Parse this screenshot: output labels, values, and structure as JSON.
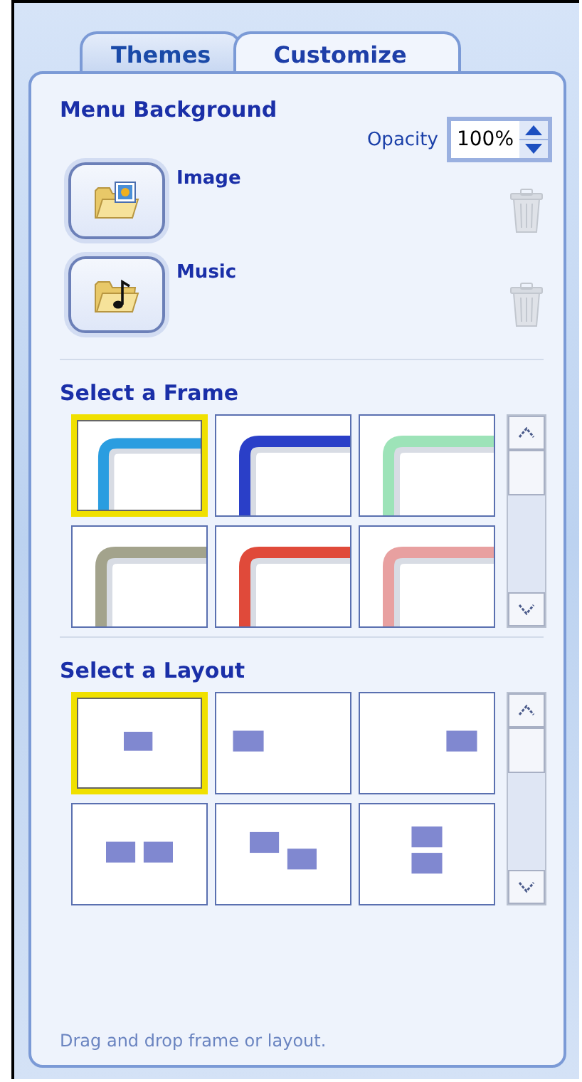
{
  "tabs": [
    {
      "label": "Themes",
      "selected": false
    },
    {
      "label": "Customize",
      "selected": true
    }
  ],
  "menu_background": {
    "heading": "Menu Background",
    "opacity": {
      "label": "Opacity",
      "value": "100%"
    },
    "items": [
      {
        "label": "Image",
        "kind": "image"
      },
      {
        "label": "Music",
        "kind": "music"
      }
    ]
  },
  "frames": {
    "heading": "Select a Frame",
    "items": [
      {
        "selected": true,
        "color": "#2a9de0"
      },
      {
        "selected": false,
        "color": "#2a3fc8"
      },
      {
        "selected": false,
        "color": "#9de3b8"
      },
      {
        "selected": false,
        "color": "#a3a38c"
      },
      {
        "selected": false,
        "color": "#e04a3a"
      },
      {
        "selected": false,
        "color": "#e8a0a0"
      }
    ]
  },
  "layouts": {
    "heading": "Select a Layout",
    "items": [
      {
        "kind": "center",
        "selected": true
      },
      {
        "kind": "left",
        "selected": false
      },
      {
        "kind": "right",
        "selected": false
      },
      {
        "kind": "pair",
        "selected": false
      },
      {
        "kind": "diagonal",
        "selected": false
      },
      {
        "kind": "stacked",
        "selected": false
      }
    ]
  },
  "footer": "Drag and drop frame or layout."
}
